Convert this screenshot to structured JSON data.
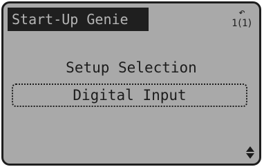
{
  "header": {
    "title": "Start-Up Genie",
    "menu_indicator": {
      "icon": "return-arrow-icon",
      "setup_number": "1(1)"
    }
  },
  "parameter": {
    "name": "Setup Selection",
    "value": "Digital Input"
  },
  "scroll": {
    "icon": "up-down-arrows-icon"
  },
  "colors": {
    "display_background": "#a9a9a9",
    "text": "#1c1c1c",
    "title_bar_background": "#1f1f1f",
    "title_bar_text": "#b5b5b5"
  }
}
